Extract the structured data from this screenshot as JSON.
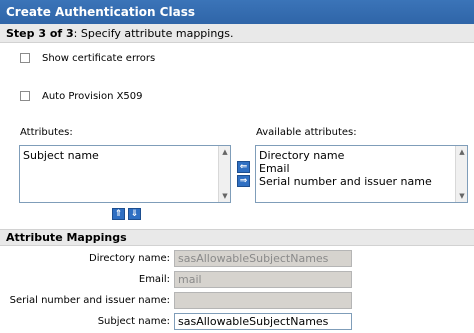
{
  "header": {
    "title": "Create Authentication Class"
  },
  "step": {
    "prefix": "Step 3 of 3",
    "text": ": Specify attribute mappings."
  },
  "options": {
    "show_cert_errors": "Show certificate errors",
    "auto_provision": "Auto Provision X509"
  },
  "attributes": {
    "label": "Attributes:",
    "items": [
      "Subject name"
    ]
  },
  "available": {
    "label": "Available attributes:",
    "items": [
      "Directory name",
      "Email",
      "Serial number and issuer name"
    ]
  },
  "mappings": {
    "title": "Attribute Mappings",
    "rows": [
      {
        "label": "Directory name:",
        "value": "sasAllowableSubjectNames",
        "disabled": true
      },
      {
        "label": "Email:",
        "value": "mail",
        "disabled": true
      },
      {
        "label": "Serial number and issuer name:",
        "value": "",
        "disabled": true
      },
      {
        "label": "Subject name:",
        "value": "sasAllowableSubjectNames",
        "disabled": false
      }
    ]
  },
  "icons": {
    "move_left": "arrow-left-icon",
    "move_right": "arrow-right-icon",
    "move_up": "arrow-up-icon",
    "move_down": "arrow-down-icon"
  }
}
